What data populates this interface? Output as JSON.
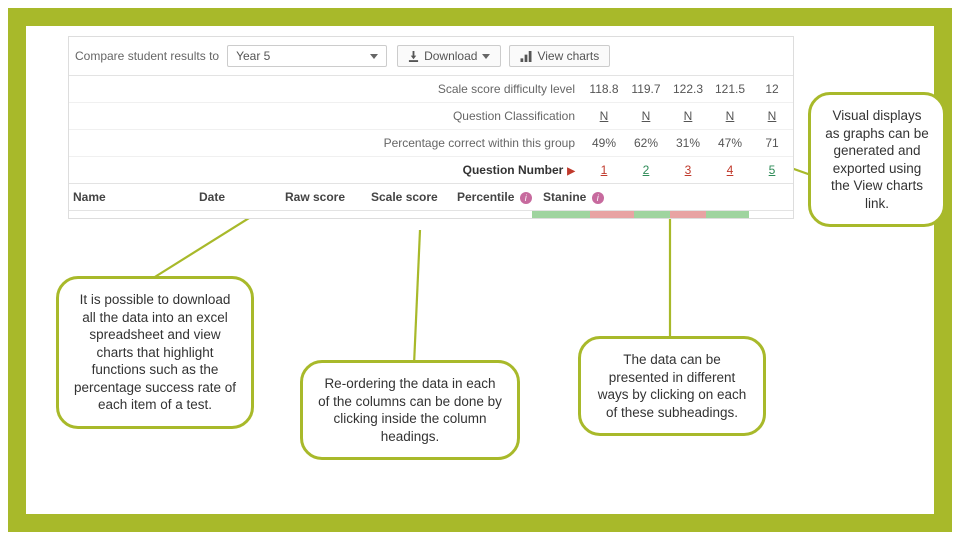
{
  "toolbar": {
    "compare_label": "Compare student results to",
    "select_value": "Year 5",
    "download_label": "Download",
    "view_charts_label": "View charts"
  },
  "rows": {
    "difficulty_label": "Scale score difficulty level",
    "classification_label": "Question Classification",
    "percentage_label": "Percentage correct within this group",
    "qnum_label": "Question Number",
    "difficulty": [
      "118.8",
      "119.7",
      "122.3",
      "121.5",
      "12"
    ],
    "classification": [
      "N",
      "N",
      "N",
      "N",
      "N"
    ],
    "percentage": [
      "49%",
      "62%",
      "31%",
      "47%",
      "71"
    ],
    "qnum": [
      "1",
      "2",
      "3",
      "4",
      "5"
    ]
  },
  "columns": {
    "name": "Name",
    "date": "Date",
    "raw": "Raw score",
    "scale": "Scale score",
    "percentile": "Percentile",
    "stanine": "Stanine",
    "info_glyph": "i"
  },
  "callouts": {
    "left": "It is possible to download all the data into an excel spreadsheet and view charts that highlight functions such as the percentage success rate of each item of a test.",
    "center": "Re-ordering the data in each of the columns can be done by clicking inside the column headings.",
    "right_small": "The data can be presented in different ways by clicking on each of these subheadings.",
    "top_right": "Visual displays as graphs can be generated and exported using the View charts link."
  }
}
